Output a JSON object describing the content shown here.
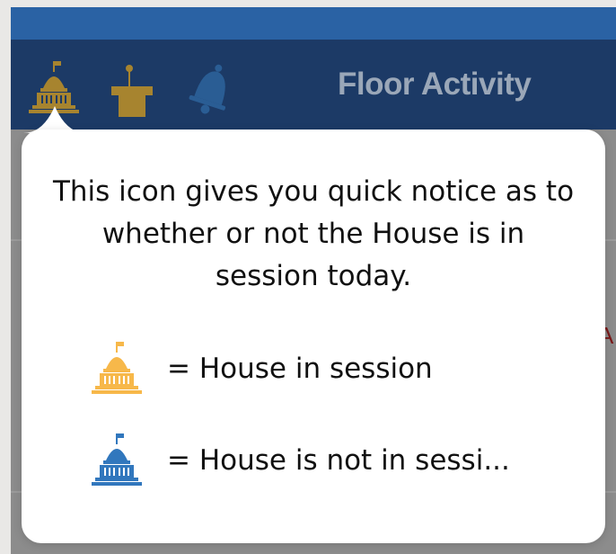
{
  "header": {
    "title": "Floor Activity",
    "icons": [
      "capitol-icon",
      "podium-icon",
      "bell-icon"
    ]
  },
  "popover": {
    "text": "This icon gives you quick notice as to whether or not the House is in session today.",
    "legend": [
      {
        "icon": "capitol-in-session-icon",
        "label": "= House in session",
        "color": "#f7b84a"
      },
      {
        "icon": "capitol-not-in-session-icon",
        "label": "= House is not in sessi...",
        "color": "#3177bd"
      }
    ]
  },
  "background": {
    "partial_text": "A"
  },
  "colors": {
    "statusbar": "#2a62a4",
    "navbar": "#1c3a66",
    "gold": "#a7842f",
    "overlay": "#8c8c8c"
  }
}
